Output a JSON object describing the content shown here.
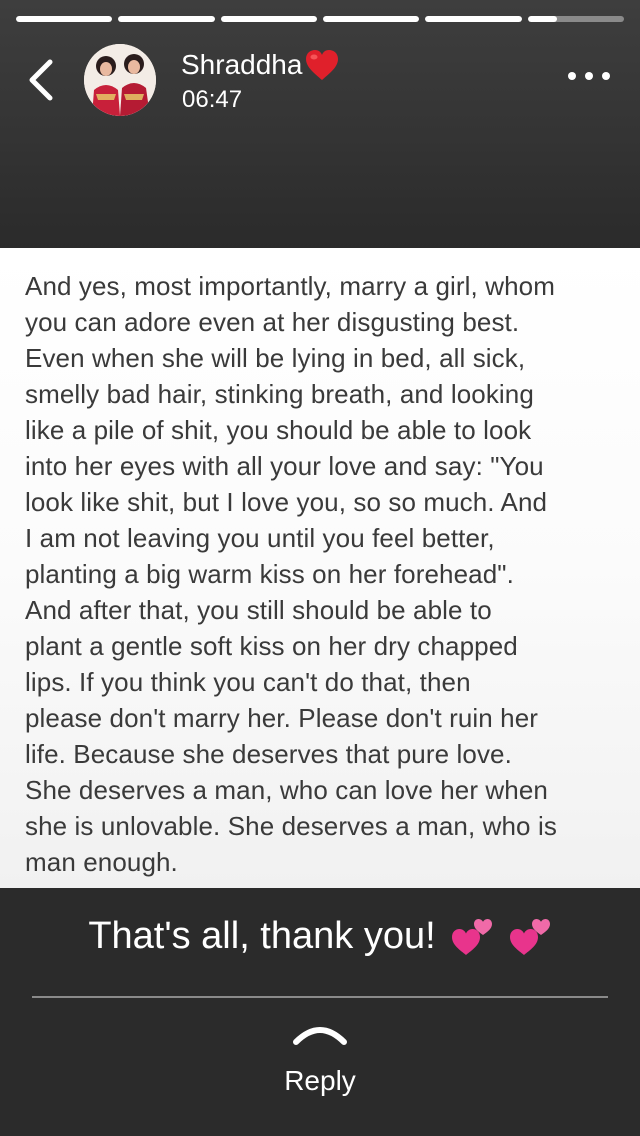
{
  "story": {
    "segments_total": 6,
    "segments_complete": 5,
    "current_segment_progress": 0.3
  },
  "header": {
    "name": "Shraddha",
    "time": "06:47"
  },
  "post": {
    "text": "And yes, most importantly, marry a girl, whom\nyou can adore even at her disgusting best.\nEven when she will be lying in bed, all sick,\nsmelly bad hair, stinking breath, and looking\nlike a pile of shit, you should be able to look\ninto her eyes with all your love and say: \"You\nlook like shit, but I love you, so so much. And\nI am not leaving you until you feel better,\nplanting a big warm kiss on her forehead\".\nAnd after that, you still should be able to\nplant a gentle soft kiss on her dry chapped\nlips. If you think you can't do that, then\nplease don't marry her. Please don't ruin her\nlife. Because she deserves that pure love.\nShe deserves a man, who can love her when\nshe is unlovable. She deserves a man, who is\nman enough."
  },
  "caption": {
    "text": "That's all, thank you!"
  },
  "reply": {
    "label": "Reply"
  },
  "icons": {
    "back": "chevron-left-icon",
    "more": "more-horizontal-icon",
    "name_emoji": "red-heart-emoji",
    "caption_emojis": [
      "two-hearts-emoji",
      "two-hearts-emoji"
    ],
    "reply": "chevron-up-icon"
  },
  "colors": {
    "accent_heart": "#e0202b",
    "pink_heart": "#e8348c"
  }
}
